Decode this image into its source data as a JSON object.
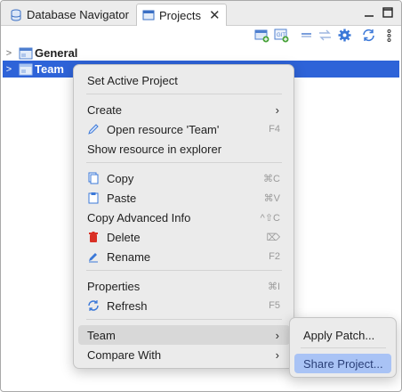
{
  "tabs": [
    {
      "label": "Database Navigator",
      "icon": "database-navigator-icon",
      "active": false
    },
    {
      "label": "Projects",
      "icon": "projects-icon",
      "active": true
    }
  ],
  "tab_close": "✕",
  "window_controls": [
    "minimize-icon",
    "maximize-icon"
  ],
  "toolbar_icons": [
    "new-project-icon",
    "git-clone-icon",
    "collapse-all-icon",
    "link-with-editor-icon",
    "settings-gear-icon",
    "refresh-sync-icon",
    "view-menu-icon"
  ],
  "tree": [
    {
      "label": "General",
      "selected": false
    },
    {
      "label": "Team",
      "selected": true
    }
  ],
  "context_menu": {
    "items": [
      {
        "label": "Set Active Project"
      },
      {
        "label": "Create",
        "submenu": true
      },
      {
        "label": "Open resource 'Team'",
        "shortcut": "F4",
        "icon": "pencil-icon"
      },
      {
        "label": "Show resource in explorer"
      },
      {
        "label": "Copy",
        "shortcut": "⌘C",
        "icon": "copy-icon"
      },
      {
        "label": "Paste",
        "shortcut": "⌘V",
        "icon": "paste-icon"
      },
      {
        "label": "Copy Advanced Info",
        "shortcut": "^⇧C"
      },
      {
        "label": "Delete",
        "shortcut": "⌦",
        "icon": "delete-icon"
      },
      {
        "label": "Rename",
        "shortcut": "F2",
        "icon": "rename-icon"
      },
      {
        "label": "Properties",
        "shortcut": "⌘I"
      },
      {
        "label": "Refresh",
        "shortcut": "F5",
        "icon": "refresh-icon"
      },
      {
        "label": "Team",
        "submenu": true
      },
      {
        "label": "Compare With",
        "submenu": true
      }
    ],
    "arrow": "›"
  },
  "team_submenu": {
    "items": [
      {
        "label": "Apply Patch..."
      },
      {
        "label": "Share Project..."
      }
    ]
  },
  "colors": {
    "selection": "#2e63d8",
    "submenu_highlight": "#a9c3f5",
    "menu_bg": "#ebebeb"
  }
}
